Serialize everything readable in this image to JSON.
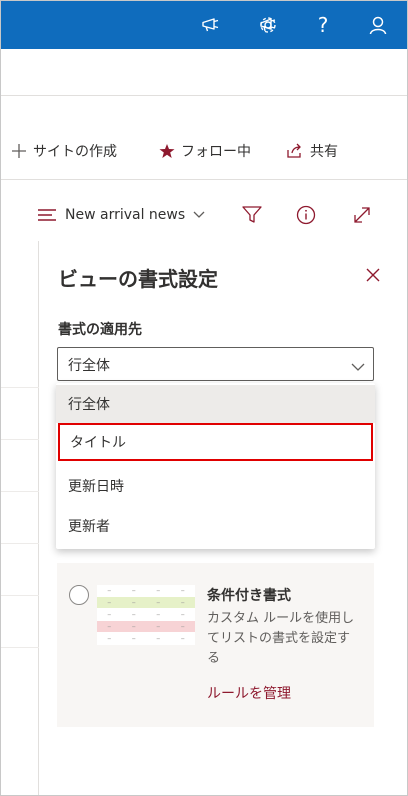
{
  "suite_bar": {
    "color": "#0f6cbd",
    "icons": [
      "megaphone-icon",
      "gear-icon",
      "help-icon",
      "person-icon"
    ],
    "help_label": "?"
  },
  "command_bar": {
    "create_site": "サイトの作成",
    "follow": "フォロー中",
    "share": "共有"
  },
  "view_bar": {
    "view_name": "New arrival news",
    "icons": [
      "filter-icon",
      "info-icon",
      "expand-icon"
    ]
  },
  "panel": {
    "title": "ビューの書式設定",
    "apply_to_label": "書式の適用先",
    "dropdown": {
      "selected": "行全体",
      "options": [
        "行全体",
        "タイトル",
        "更新日時",
        "更新者"
      ]
    },
    "conditional": {
      "title": "条件付き書式",
      "description": "カスタム ルールを使用してリストの書式を設定する",
      "link": "ルールを管理"
    }
  },
  "colors": {
    "accent": "#0f6cbd",
    "link": "#8e192e",
    "highlight_box": "#e00000",
    "row_green": "#e6f1c8",
    "row_red": "#f7d3d5"
  }
}
